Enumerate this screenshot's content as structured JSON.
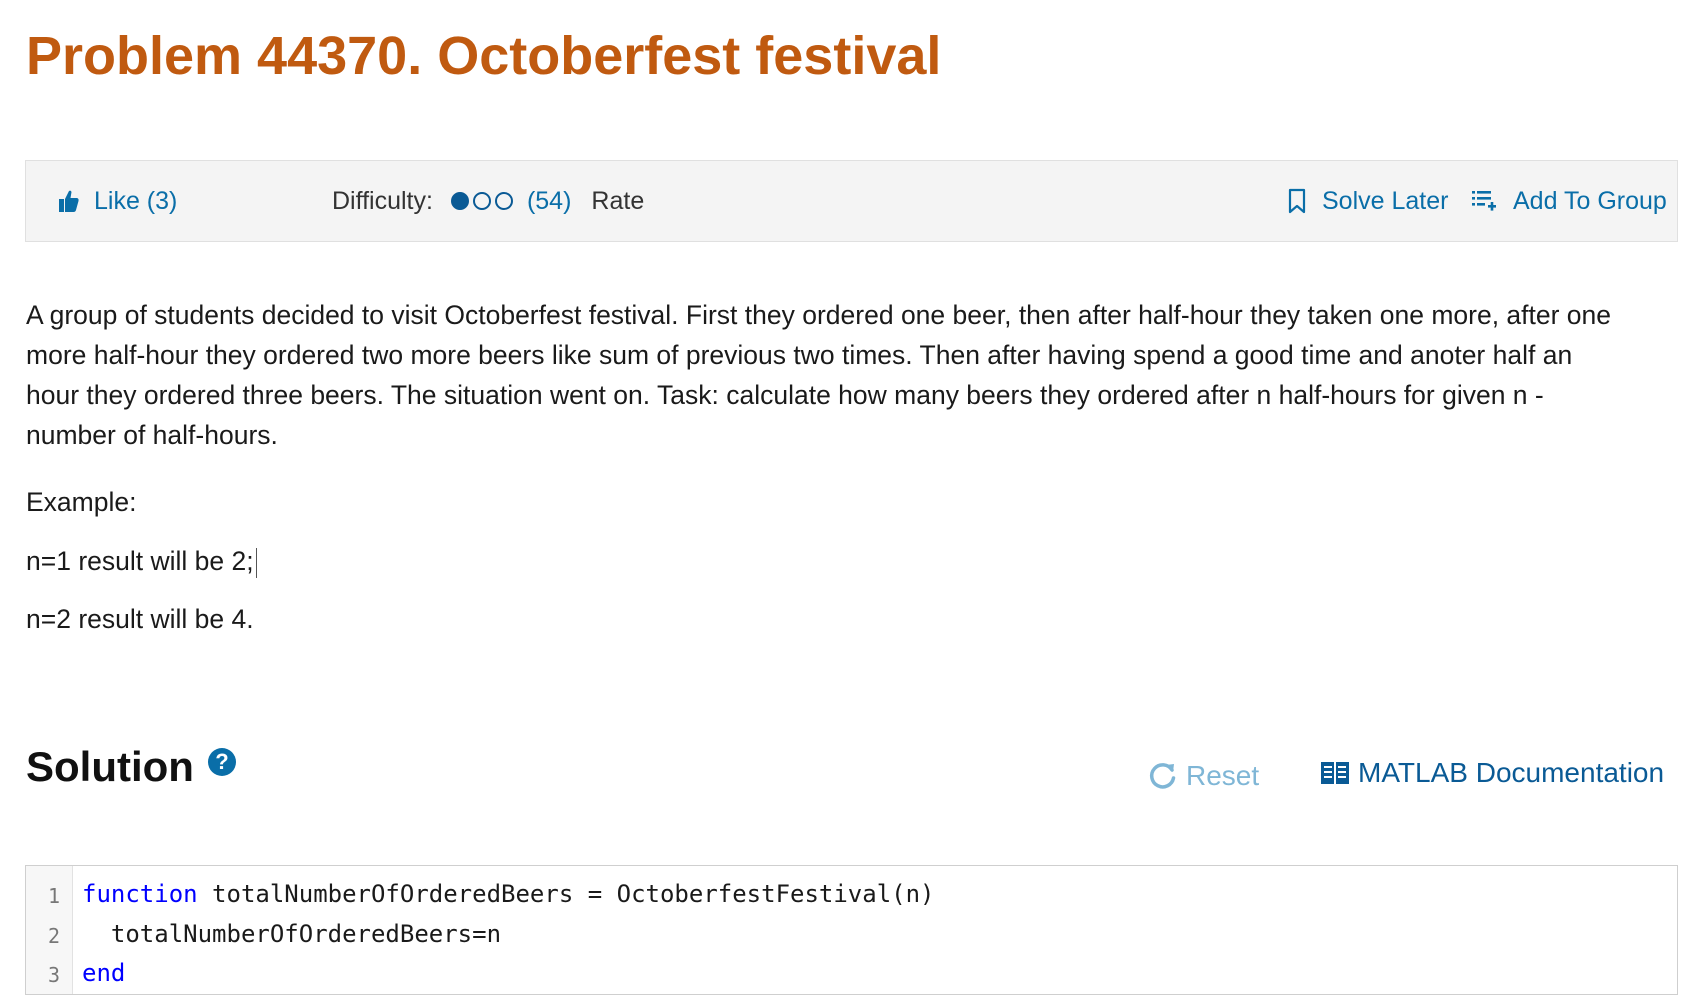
{
  "problem": {
    "title": "Problem 44370. Octoberfest festival"
  },
  "toolbar": {
    "like_label": "Like (3)",
    "difficulty_label": "Difficulty:",
    "difficulty_level": 1,
    "difficulty_max": 3,
    "difficulty_count": "(54)",
    "rate_label": "Rate",
    "solve_later_label": "Solve Later",
    "add_group_label": "Add To Group"
  },
  "description": {
    "paragraph": "A group of students decided to visit Octoberfest festival. First they ordered one beer, then after half-hour they taken one more, after one more half-hour they ordered two more beers like sum of previous two times. Then after having spend a good time and anoter half an hour they ordered three beers. The situation went on. Task: calculate how many beers they ordered after n half-hours for given n - number of half-hours.",
    "example_label": "Example:",
    "example1": "n=1 result will be 2;",
    "example2": "n=2 result will be 4."
  },
  "solution": {
    "title": "Solution",
    "help_icon": "?",
    "reset_label": "Reset",
    "doc_label": "MATLAB Documentation"
  },
  "editor": {
    "line_numbers": [
      "1",
      "2",
      "3"
    ],
    "line1_keyword": "function",
    "line1_rest": " totalNumberOfOrderedBeers = OctoberfestFestival(n)",
    "line2": "  totalNumberOfOrderedBeers=n",
    "line3_keyword": "end"
  },
  "colors": {
    "title": "#c05a10",
    "link": "#0a6ea8",
    "keyword": "#0000ff"
  }
}
